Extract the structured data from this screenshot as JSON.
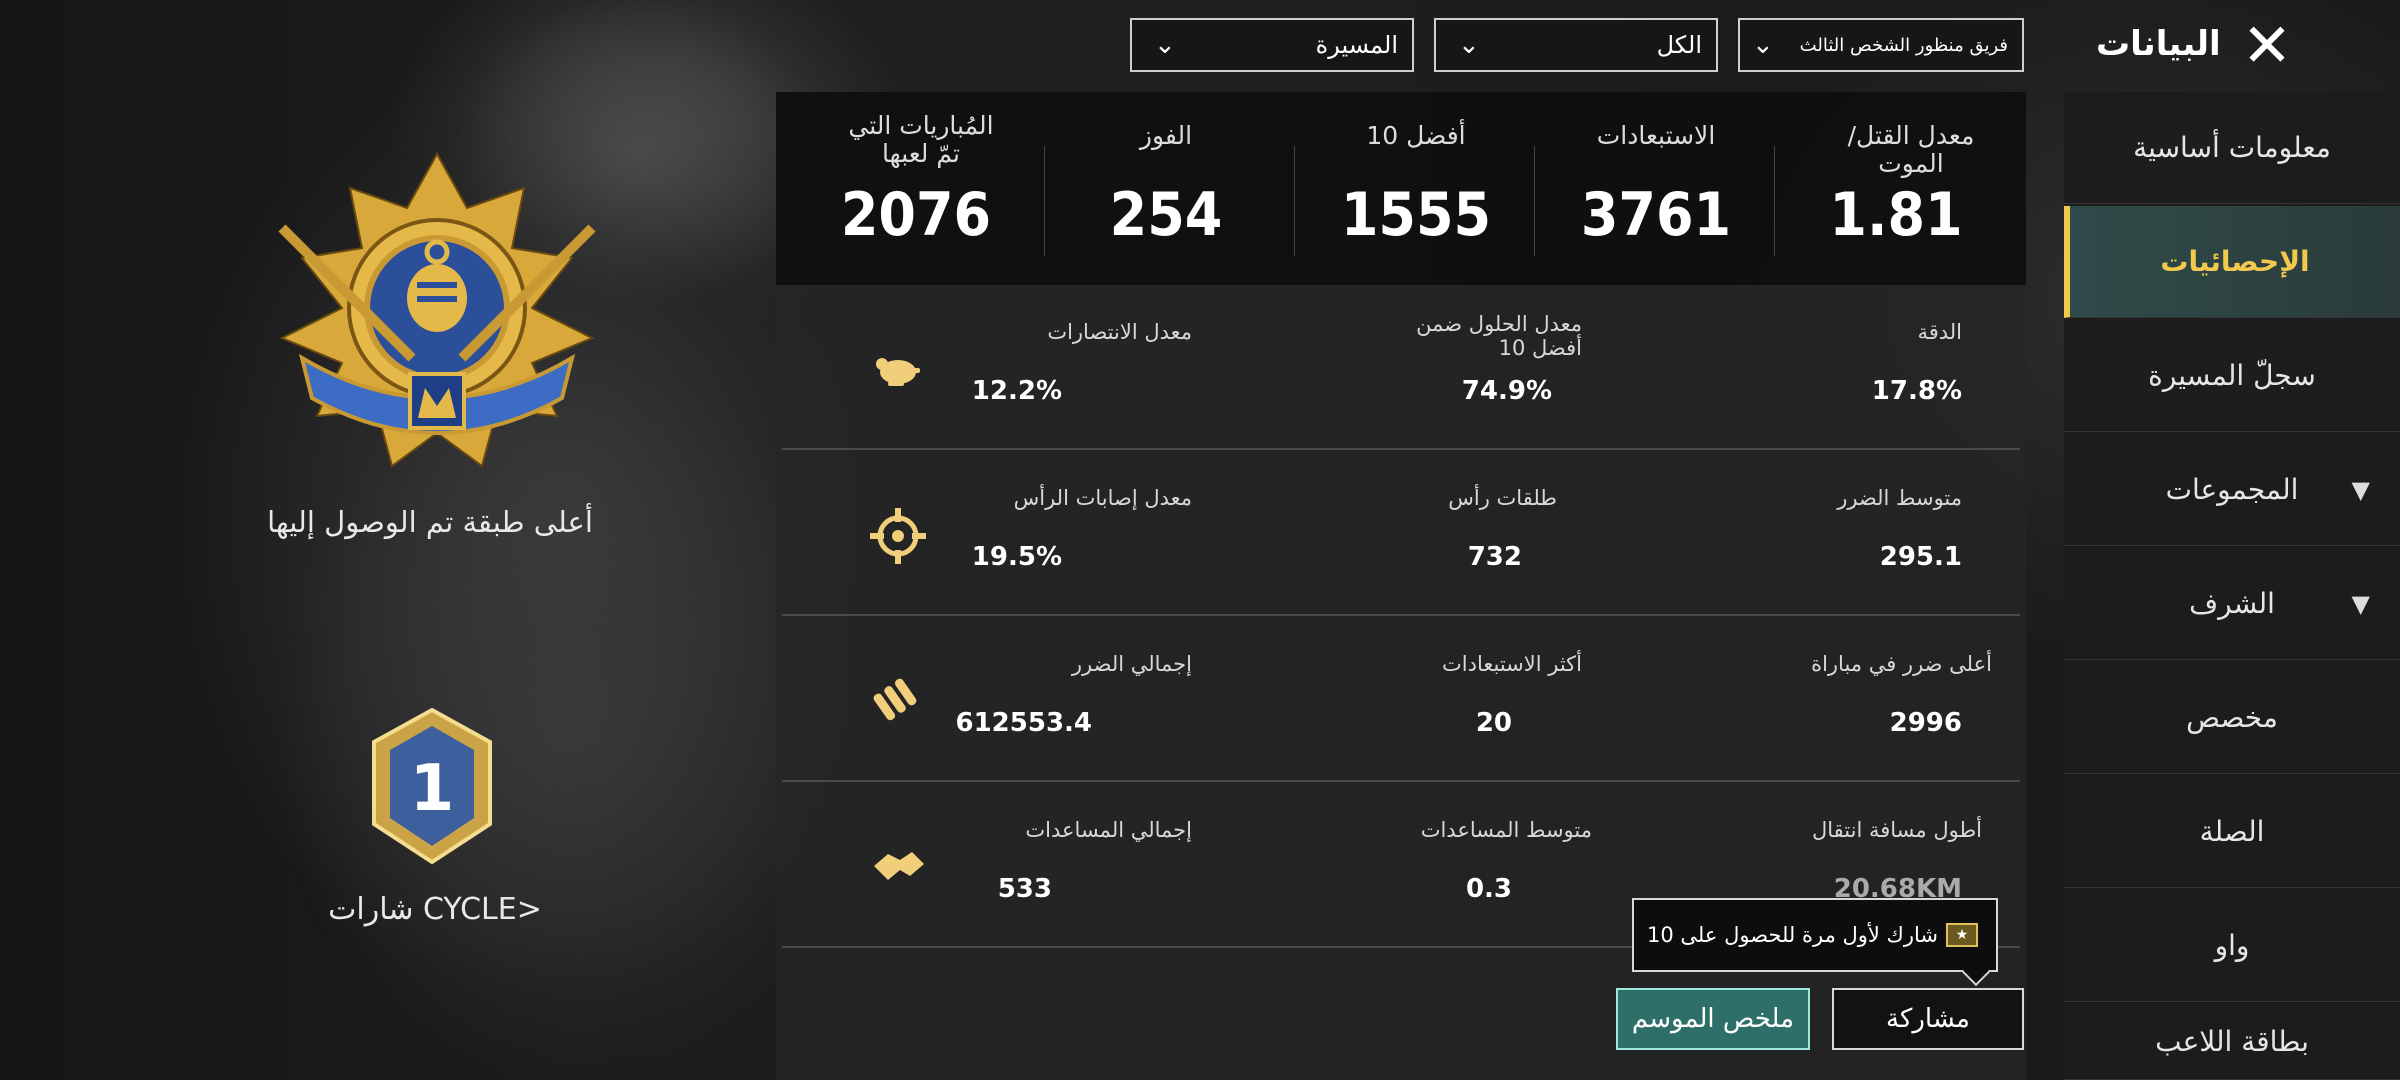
{
  "header": {
    "title": "البيانات",
    "close_icon": "close-icon",
    "dropdowns": [
      {
        "label": "فريق منظور الشخص الثالث"
      },
      {
        "label": "الكل"
      },
      {
        "label": "المسيرة"
      }
    ]
  },
  "sidebar": {
    "items": [
      {
        "label": "معلومات أساسية"
      },
      {
        "label": "الإحصائيات",
        "active": true
      },
      {
        "label": "سجلّ المسيرة"
      },
      {
        "label": "المجموعات",
        "expandable": true
      },
      {
        "label": "الشرف",
        "expandable": true
      },
      {
        "label": "مخصص"
      },
      {
        "label": "الصلة"
      },
      {
        "label": "واو"
      },
      {
        "label": "بطاقة اللاعب"
      }
    ]
  },
  "summary": [
    {
      "label": "معدل القتل/ الموت",
      "value": "1.81"
    },
    {
      "label": "الاستبعادات",
      "value": "3761"
    },
    {
      "label": "أفضل 10",
      "value": "1555"
    },
    {
      "label": "الفوز",
      "value": "254"
    },
    {
      "label": "المُباريات التي تمّ لعبها",
      "value": "2076"
    }
  ],
  "rows": [
    {
      "icon": "chicken-icon",
      "stats": [
        {
          "label": "الدقة",
          "value": "17.8%"
        },
        {
          "label": "معدل الحلول ضمن أفضل 10",
          "value": "74.9%"
        },
        {
          "label": "معدل الانتصارات",
          "value": "12.2%"
        }
      ]
    },
    {
      "icon": "crosshair-icon",
      "stats": [
        {
          "label": "متوسط الضرر",
          "value": "295.1"
        },
        {
          "label": "طلقات رأس",
          "value": "732"
        },
        {
          "label": "معدل إصابات الرأس",
          "value": "19.5%"
        }
      ]
    },
    {
      "icon": "bullets-icon",
      "stats": [
        {
          "label": "أعلى ضرر في مباراة",
          "value": "2996"
        },
        {
          "label": "أكثر الاستبعادات",
          "value": "20"
        },
        {
          "label": "إجمالي الضرر",
          "value": "612553.4"
        }
      ]
    },
    {
      "icon": "handshake-icon",
      "stats": [
        {
          "label": "أطول مسافة انتقال",
          "value": "20.68KM"
        },
        {
          "label": "متوسط المساعدات",
          "value": "0.3"
        },
        {
          "label": "إجمالي المساعدات",
          "value": "533"
        }
      ]
    }
  ],
  "left": {
    "tier_caption": "أعلى طبقة تم الوصول إليها",
    "cycle_caption": "شارات CYCLE>",
    "cycle_number": "1"
  },
  "footer": {
    "tooltip": "شارك لأول مرة للحصول على 10",
    "share_button": "مشاركة",
    "season_button": "ملخص الموسم"
  },
  "colors": {
    "accent": "#f2c94c",
    "season_btn": "#2f6f69"
  }
}
